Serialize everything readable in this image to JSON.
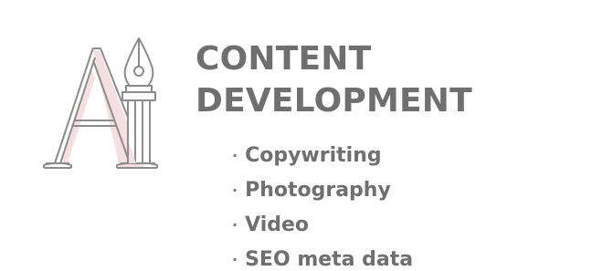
{
  "title": {
    "line1": "CONTENT",
    "line2": "DEVELOPMENT"
  },
  "logo": {
    "icon": "letter-a-fountain-pen-icon",
    "accent_color": "#f6dfe0",
    "stroke_color": "#8c8c8c"
  },
  "services": {
    "bullet": "·",
    "items": [
      {
        "label": "Copywriting"
      },
      {
        "label": "Photography"
      },
      {
        "label": "Video"
      },
      {
        "label": "SEO meta data"
      }
    ]
  },
  "colors": {
    "text": "#6f6f6f",
    "background": "#ffffff"
  }
}
